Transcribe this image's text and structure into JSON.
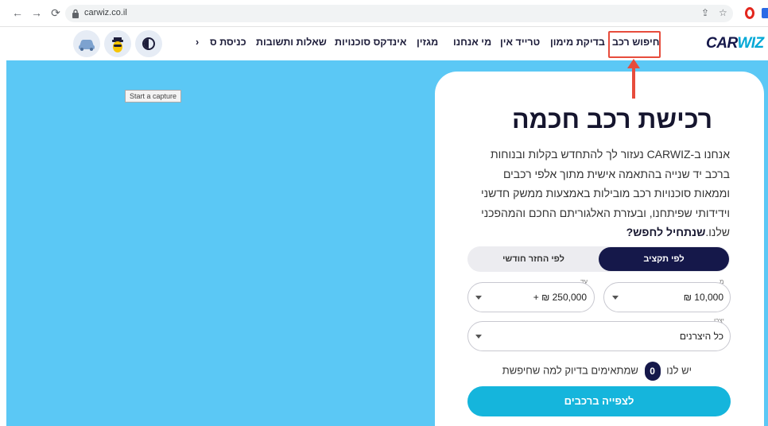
{
  "browser": {
    "url": "carwiz.co.il"
  },
  "header": {
    "logo_car": "CAR",
    "logo_wiz": "WIZ",
    "nav": [
      "חיפוש רכב",
      "בדיקת מימון",
      "טרייד אין",
      "מי אנחנו",
      "מגזין",
      "אינדקס סוכנויות",
      "שאלות ותשובות",
      "כניסת ס"
    ],
    "nav_more": "‹"
  },
  "tooltip": "Start a capture",
  "hero": {
    "title": "רכישת רכב חכמה",
    "desc_main": "אנחנו ב-CARWIZ נעזור לך להתחדש בקלות ובנוחות ברכב יד שנייה בהתאמה אישית מתוך אלפי רכבים וממאות סוכנויות רכב מובילות באמצעות ממשק חדשני וידידותי שפיתחנו, ובעזרת האלגוריתם החכם והמהפכני שלנו.",
    "desc_bold": "שנתחיל לחפש?",
    "toggle_active": "לפי תקציב",
    "toggle_inactive": "לפי החזר חודשי",
    "from_label": "מ",
    "from_value": "10,000 ₪",
    "to_label": "עד",
    "to_value": "250,000 ₪ +",
    "maker_label": "יצרן",
    "maker_value": "כל היצרנים",
    "count_prefix": "יש לנו",
    "count_value": "0",
    "count_suffix": "שמתאימים בדיוק למה שחיפשת",
    "cta": "לצפייה ברכבים"
  },
  "colors": {
    "hero_bg": "#5bc8f5",
    "brand_dark": "#15184a",
    "brand_light": "#00a8d6",
    "cta": "#15b5dc",
    "annotation": "#e74c3c"
  }
}
